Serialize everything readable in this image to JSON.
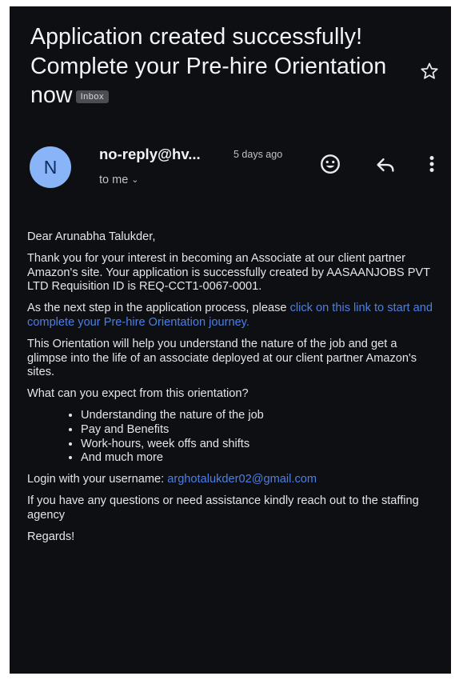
{
  "email": {
    "subject": "Application created successfully! Complete your Pre-hire Orientation now",
    "label": "Inbox",
    "sender": {
      "initial": "N",
      "name": "no-reply@hv...",
      "time": "5 days ago",
      "recipient": "to me"
    },
    "icons": {
      "star": "star-icon",
      "emoji": "emoji-icon",
      "reply": "reply-icon",
      "more": "more-vert-icon",
      "expand": "chevron-down-icon"
    },
    "body": {
      "greeting": "Dear Arunabha Talukder,",
      "paragraph1": "Thank you for your interest in becoming an Associate at our client partner Amazon's site. Your application is successfully created by AASAANJOBS PVT LTD Requisition ID is REQ-CCT1-0067-0001.",
      "paragraph2_text": "As the next step in the application process, please ",
      "paragraph2_link": "click on this link to start and complete your Pre-hire Orientation journey.",
      "paragraph3": "This Orientation will help you understand the nature of the job and get a glimpse into the life of an associate deployed at our client partner Amazon's sites.",
      "question": "What can you expect from this orientation?",
      "bullets": [
        "Understanding the nature of the job",
        "Pay and Benefits",
        "Work-hours, week offs and shifts",
        "And much more"
      ],
      "login_text": "Login with your username: ",
      "login_email": "arghotalukder02@gmail.com",
      "assistance": "If you have any questions or need assistance kindly reach out to the staffing agency",
      "closing": "Regards!"
    }
  },
  "colors": {
    "background": "#0e0f12",
    "link": "#4c7fe6",
    "avatar": "#8ab4f8"
  }
}
